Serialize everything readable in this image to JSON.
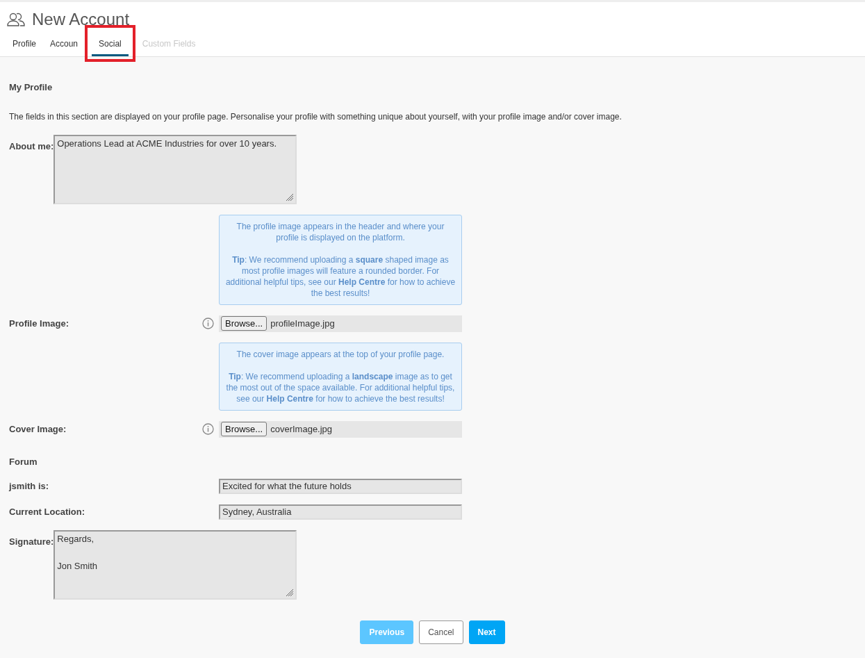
{
  "header": {
    "title": "New Account"
  },
  "tabs": [
    {
      "label": "Profile",
      "selected": false,
      "disabled": false,
      "highlighted": false
    },
    {
      "label": "Accoun",
      "selected": false,
      "disabled": false,
      "highlighted": false
    },
    {
      "label": "Social",
      "selected": true,
      "disabled": false,
      "highlighted": true
    },
    {
      "label": "Custom Fields",
      "selected": false,
      "disabled": true,
      "highlighted": false
    }
  ],
  "section": {
    "title": "My Profile",
    "description": "The fields in this section are displayed on your profile page. Personalise your profile with something unique about yourself, with your profile image and/or cover image."
  },
  "rows": [
    {
      "kind": "textarea",
      "label": "About me:",
      "value": "Operations Lead at ACME Industries for over 10 years."
    },
    {
      "kind": "info",
      "paragraphs": [
        "The profile image appears in the header and where your profile is displayed on the platform.",
        "**Tip**: We recommend uploading a **square** shaped image as most profile images will feature a rounded border. For additional helpful tips, see our **Help Centre** for how to achieve the best results!"
      ]
    },
    {
      "kind": "file",
      "label": "Profile Image:",
      "button": "Browse...",
      "value": "profileImage.jpg"
    },
    {
      "kind": "info",
      "paragraphs": [
        "The cover image appears at the top of your profile page.",
        "**Tip**: We recommend uploading a **landscape** image as to get the most out of the space available. For additional helpful tips, see our **Help Centre** for how to achieve the best results!"
      ]
    },
    {
      "kind": "file",
      "label": "Cover Image:",
      "button": "Browse...",
      "value": "coverImage.jpg"
    },
    {
      "kind": "heading",
      "label": "Forum"
    },
    {
      "kind": "text",
      "label": "jsmith is:",
      "value": "Excited for what the future holds"
    },
    {
      "kind": "text",
      "label": "Current Location:",
      "value": "Sydney, Australia"
    },
    {
      "kind": "textarea",
      "label": "Signature:",
      "value": "Regards,\n\nJon Smith"
    }
  ],
  "buttons": [
    {
      "kind": "previous",
      "label": "Previous"
    },
    {
      "kind": "cancel",
      "label": "Cancel"
    },
    {
      "kind": "next",
      "label": "Next"
    }
  ]
}
